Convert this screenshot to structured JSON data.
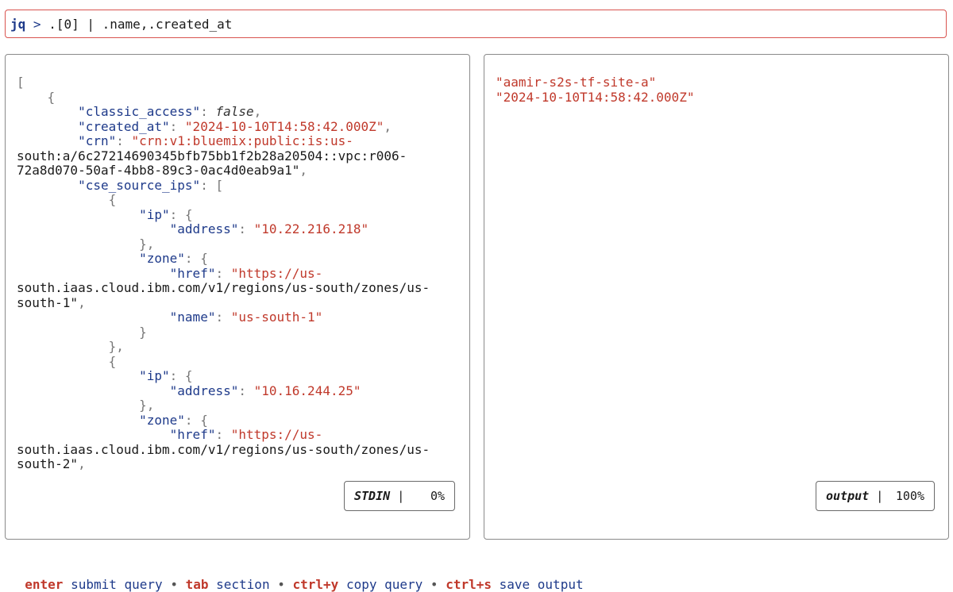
{
  "query": {
    "prompt": "jq",
    "arrow": ">",
    "text": ".[0] | .name,.created_at"
  },
  "input_pane": {
    "lines": [
      [
        {
          "c": "p",
          "t": "["
        }
      ],
      [
        {
          "c": "p",
          "t": "    {"
        }
      ],
      [
        {
          "c": "p",
          "t": "        "
        },
        {
          "c": "k",
          "t": "\"classic_access\""
        },
        {
          "c": "p",
          "t": ": "
        },
        {
          "c": "b",
          "t": "false"
        },
        {
          "c": "p",
          "t": ","
        }
      ],
      [
        {
          "c": "p",
          "t": "        "
        },
        {
          "c": "k",
          "t": "\"created_at\""
        },
        {
          "c": "p",
          "t": ": "
        },
        {
          "c": "s",
          "t": "\"2024-10-10T14:58:42.000Z\""
        },
        {
          "c": "p",
          "t": ","
        }
      ],
      [
        {
          "c": "p",
          "t": "        "
        },
        {
          "c": "k",
          "t": "\"crn\""
        },
        {
          "c": "p",
          "t": ": "
        },
        {
          "c": "s",
          "t": "\"crn:v1:bluemix:public:is:us-"
        }
      ],
      [
        {
          "c": "t",
          "t": "south:a/6c27214690345bfb75bb1f2b28a20504::vpc:r006-"
        }
      ],
      [
        {
          "c": "t",
          "t": "72a8d070-50af-4bb8-89c3-0ac4d0eab9a1\""
        },
        {
          "c": "p",
          "t": ","
        }
      ],
      [
        {
          "c": "p",
          "t": "        "
        },
        {
          "c": "k",
          "t": "\"cse_source_ips\""
        },
        {
          "c": "p",
          "t": ": ["
        }
      ],
      [
        {
          "c": "p",
          "t": "            {"
        }
      ],
      [
        {
          "c": "p",
          "t": "                "
        },
        {
          "c": "k",
          "t": "\"ip\""
        },
        {
          "c": "p",
          "t": ": {"
        }
      ],
      [
        {
          "c": "p",
          "t": "                    "
        },
        {
          "c": "k",
          "t": "\"address\""
        },
        {
          "c": "p",
          "t": ": "
        },
        {
          "c": "s",
          "t": "\"10.22.216.218\""
        }
      ],
      [
        {
          "c": "p",
          "t": "                },"
        }
      ],
      [
        {
          "c": "p",
          "t": "                "
        },
        {
          "c": "k",
          "t": "\"zone\""
        },
        {
          "c": "p",
          "t": ": {"
        }
      ],
      [
        {
          "c": "p",
          "t": "                    "
        },
        {
          "c": "k",
          "t": "\"href\""
        },
        {
          "c": "p",
          "t": ": "
        },
        {
          "c": "s",
          "t": "\"https://us-"
        }
      ],
      [
        {
          "c": "t",
          "t": "south.iaas.cloud.ibm.com/v1/regions/us-south/zones/us-"
        }
      ],
      [
        {
          "c": "t",
          "t": "south-1\""
        },
        {
          "c": "p",
          "t": ","
        }
      ],
      [
        {
          "c": "p",
          "t": "                    "
        },
        {
          "c": "k",
          "t": "\"name\""
        },
        {
          "c": "p",
          "t": ": "
        },
        {
          "c": "s",
          "t": "\"us-south-1\""
        }
      ],
      [
        {
          "c": "p",
          "t": "                }"
        }
      ],
      [
        {
          "c": "p",
          "t": "            },"
        }
      ],
      [
        {
          "c": "p",
          "t": "            {"
        }
      ],
      [
        {
          "c": "p",
          "t": "                "
        },
        {
          "c": "k",
          "t": "\"ip\""
        },
        {
          "c": "p",
          "t": ": {"
        }
      ],
      [
        {
          "c": "p",
          "t": "                    "
        },
        {
          "c": "k",
          "t": "\"address\""
        },
        {
          "c": "p",
          "t": ": "
        },
        {
          "c": "s",
          "t": "\"10.16.244.25\""
        }
      ],
      [
        {
          "c": "p",
          "t": "                },"
        }
      ],
      [
        {
          "c": "p",
          "t": "                "
        },
        {
          "c": "k",
          "t": "\"zone\""
        },
        {
          "c": "p",
          "t": ": {"
        }
      ],
      [
        {
          "c": "p",
          "t": "                    "
        },
        {
          "c": "k",
          "t": "\"href\""
        },
        {
          "c": "p",
          "t": ": "
        },
        {
          "c": "s",
          "t": "\"https://us-"
        }
      ],
      [
        {
          "c": "t",
          "t": "south.iaas.cloud.ibm.com/v1/regions/us-south/zones/us-"
        }
      ],
      [
        {
          "c": "t",
          "t": "south-2\""
        },
        {
          "c": "p",
          "t": ","
        }
      ]
    ],
    "status": {
      "name": "STDIN",
      "separator": "|",
      "percent": "0%"
    }
  },
  "output_pane": {
    "lines": [
      "\"aamir-s2s-tf-site-a\"",
      "\"2024-10-10T14:58:42.000Z\""
    ],
    "status": {
      "name": "output",
      "separator": "|",
      "percent": "100%"
    }
  },
  "help": [
    {
      "key": "enter",
      "desc": "submit query"
    },
    {
      "key": "tab",
      "desc": "section"
    },
    {
      "key": "ctrl+y",
      "desc": "copy query"
    },
    {
      "key": "ctrl+s",
      "desc": "save output"
    }
  ],
  "help_separator": "•",
  "colors": {
    "query_border": "#d9534f",
    "key_color": "#1e3a8a",
    "string_color": "#c0392b"
  }
}
